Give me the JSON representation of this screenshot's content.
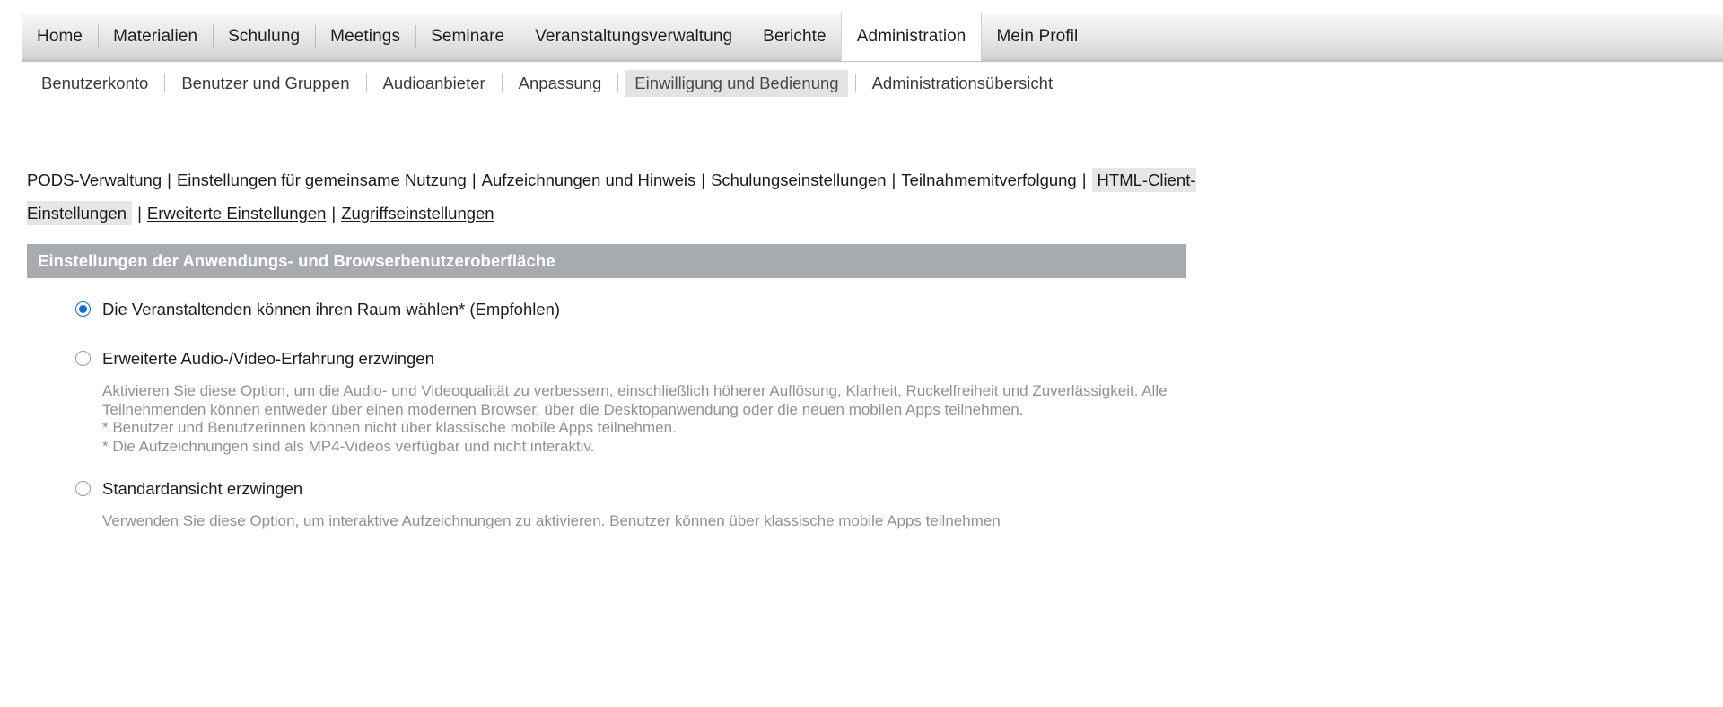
{
  "main_tabs": [
    {
      "label": "Home",
      "active": false
    },
    {
      "label": "Materialien",
      "active": false
    },
    {
      "label": "Schulung",
      "active": false
    },
    {
      "label": "Meetings",
      "active": false
    },
    {
      "label": "Seminare",
      "active": false
    },
    {
      "label": "Veranstaltungsverwaltung",
      "active": false
    },
    {
      "label": "Berichte",
      "active": false
    },
    {
      "label": "Administration",
      "active": true
    },
    {
      "label": "Mein Profil",
      "active": false
    }
  ],
  "sub_nav": [
    {
      "label": "Benutzerkonto",
      "current": false
    },
    {
      "label": "Benutzer und Gruppen",
      "current": false
    },
    {
      "label": "Audioanbieter",
      "current": false
    },
    {
      "label": "Anpassung",
      "current": false
    },
    {
      "label": "Einwilligung und Bedienung",
      "current": true
    },
    {
      "label": "Administrationsübersicht",
      "current": false
    }
  ],
  "link_bar": [
    {
      "label": "PODS-Verwaltung",
      "current": false
    },
    {
      "label": "Einstellungen für gemeinsame Nutzung",
      "current": false
    },
    {
      "label": "Aufzeichnungen und Hinweis",
      "current": false
    },
    {
      "label": "Schulungseinstellungen",
      "current": false
    },
    {
      "label": "Teilnahmemitverfolgung",
      "current": false
    },
    {
      "label": "HTML-Client-Einstellungen",
      "current": true
    },
    {
      "label": "Erweiterte Einstellungen",
      "current": false
    },
    {
      "label": "Zugriffseinstellungen",
      "current": false
    }
  ],
  "section": {
    "title": "Einstellungen der Anwendungs- und Browserbenutzeroberfläche",
    "header_bg": "#a7abaf"
  },
  "options": [
    {
      "label": "Die Veranstaltenden können ihren Raum wählen* (Empfohlen)",
      "selected": true,
      "description": []
    },
    {
      "label": "Erweiterte Audio-/Video-Erfahrung erzwingen",
      "selected": false,
      "description": [
        "Aktivieren Sie diese Option, um die Audio- und Videoqualität zu verbessern, einschließlich höherer Auflösung, Klarheit, Ruckelfreiheit und Zuverlässigkeit. Alle Teilnehmenden können entweder über einen modernen Browser, über die Desktopanwendung oder die neuen mobilen Apps teilnehmen.",
        "* Benutzer und Benutzerinnen können nicht über klassische mobile Apps teilnehmen.",
        "* Die Aufzeichnungen sind als MP4-Videos verfügbar und nicht interaktiv."
      ]
    },
    {
      "label": "Standardansicht erzwingen",
      "selected": false,
      "description": [
        "Verwenden Sie diese Option, um interaktive Aufzeichnungen zu aktivieren. Benutzer können über klassische mobile Apps teilnehmen"
      ]
    }
  ],
  "colors": {
    "accent": "#1071c4",
    "section_header": "#a7abaf",
    "highlight": "#e3e3e3",
    "muted_text": "#8d9297"
  }
}
